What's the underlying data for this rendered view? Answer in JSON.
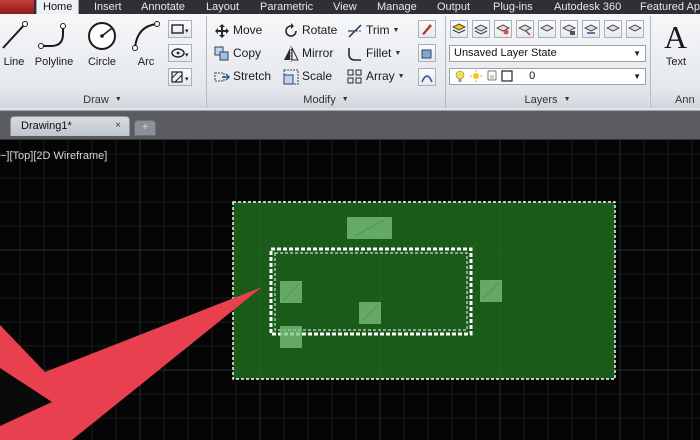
{
  "ribbon_tabs": [
    "Home",
    "Insert",
    "Annotate",
    "Layout",
    "Parametric",
    "View",
    "Manage",
    "Output",
    "Plug-ins",
    "Autodesk 360",
    "Featured Ap"
  ],
  "active_tab": "Home",
  "draw_panel": {
    "title": "Draw",
    "tools": [
      "Line",
      "Polyline",
      "Circle",
      "Arc"
    ]
  },
  "modify_panel": {
    "title": "Modify",
    "col1": [
      "Move",
      "Copy",
      "Stretch"
    ],
    "col2": [
      "Rotate",
      "Mirror",
      "Scale"
    ],
    "col3": [
      "Trim",
      "Fillet",
      "Array"
    ]
  },
  "layers_panel": {
    "title": "Layers",
    "layer_state": "Unsaved Layer State",
    "current_layer": "0"
  },
  "annotation_panel": {
    "tool": "Text",
    "title_partial": "Ann"
  },
  "file_tab": {
    "name": "Drawing1*",
    "close_glyph": "×"
  },
  "viewport_label": "−][Top][2D Wireframe]",
  "colors": {
    "selection_fill": "#1e6b1e",
    "grip": "#7ec47e",
    "pointer_arrow": "#e8404f",
    "canvas": "#050505"
  }
}
